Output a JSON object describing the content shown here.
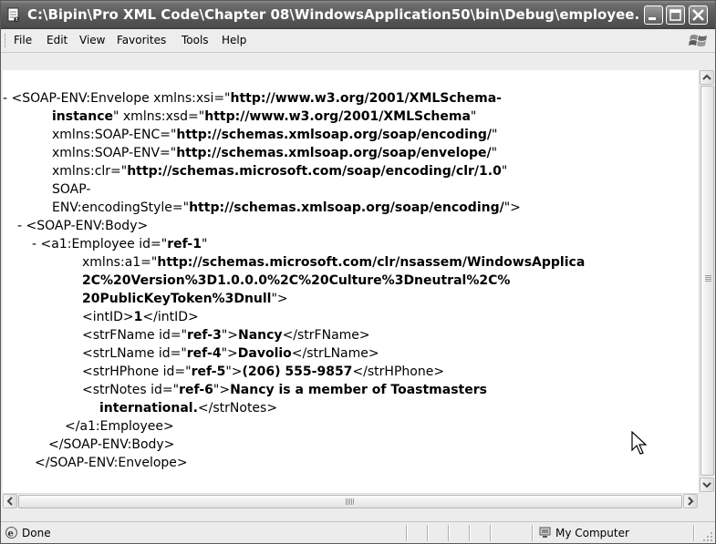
{
  "window": {
    "title": "C:\\Bipin\\Pro XML Code\\Chapter 08\\WindowsApplication50\\bin\\Debug\\employee....",
    "icon": "ie-document-icon",
    "buttons": [
      "minimize-icon",
      "maximize-icon",
      "close-icon"
    ]
  },
  "menu": {
    "items": [
      "File",
      "Edit",
      "View",
      "Favorites",
      "Tools",
      "Help"
    ]
  },
  "xml": {
    "l1_minus": "-",
    "l1_a": "<SOAP-ENV:Envelope xmlns:xsi=\"",
    "l1_b": "http://www.w3.org/2001/XMLSchema-",
    "l2_a": "instance",
    "l2_b": "\" xmlns:xsd=\"",
    "l2_c": "http://www.w3.org/2001/XMLSchema",
    "l2_d": "\"",
    "l3_a": "xmlns:SOAP-ENC=\"",
    "l3_b": "http://schemas.xmlsoap.org/soap/encoding/",
    "l3_c": "\"",
    "l4_a": "xmlns:SOAP-ENV=\"",
    "l4_b": "http://schemas.xmlsoap.org/soap/envelope/",
    "l4_c": "\"",
    "l5_a": "xmlns:clr=\"",
    "l5_b": "http://schemas.microsoft.com/soap/encoding/clr/1.0",
    "l5_c": "\"",
    "l6_a": "SOAP-",
    "l7_a": "ENV:encodingStyle=\"",
    "l7_b": "http://schemas.xmlsoap.org/soap/encoding/",
    "l7_c": "\">",
    "l8_minus": "-",
    "l8_a": "<SOAP-ENV:Body>",
    "l9_minus": "-",
    "l9_a": "<a1:Employee id=\"",
    "l9_b": "ref-1",
    "l9_c": "\"",
    "l10_a": "xmlns:a1=\"",
    "l10_b": "http://schemas.microsoft.com/clr/nsassem/WindowsApplica",
    "l11_b": "2C%20Version%3D1.0.0.0%2C%20Culture%3Dneutral%2C%",
    "l12_b": "20PublicKeyToken%3Dnull",
    "l12_c": "\">",
    "l13_a": "<intID>",
    "l13_b": "1",
    "l13_c": "</intID>",
    "l14_a": "<strFName id=\"",
    "l14_b": "ref-3",
    "l14_c": "\">",
    "l14_d": "Nancy",
    "l14_e": "</strFName>",
    "l15_a": "<strLName id=\"",
    "l15_b": "ref-4",
    "l15_c": "\">",
    "l15_d": "Davolio",
    "l15_e": "</strLName>",
    "l16_a": "<strHPhone id=\"",
    "l16_b": "ref-5",
    "l16_c": "\">",
    "l16_d": "(206) 555-9857",
    "l16_e": "</strHPhone>",
    "l17_a": "<strNotes id=\"",
    "l17_b": "ref-6",
    "l17_c": "\">",
    "l17_d": "Nancy is a member of Toastmasters",
    "l18_b": "international.",
    "l18_c": "</strNotes>",
    "l19_a": "</a1:Employee>",
    "l20_a": "</SOAP-ENV:Body>",
    "l21_a": "</SOAP-ENV:Envelope>"
  },
  "status": {
    "text": "Done",
    "zone": "My Computer",
    "icon": "ie-page-icon",
    "zone_icon": "my-computer-icon"
  }
}
